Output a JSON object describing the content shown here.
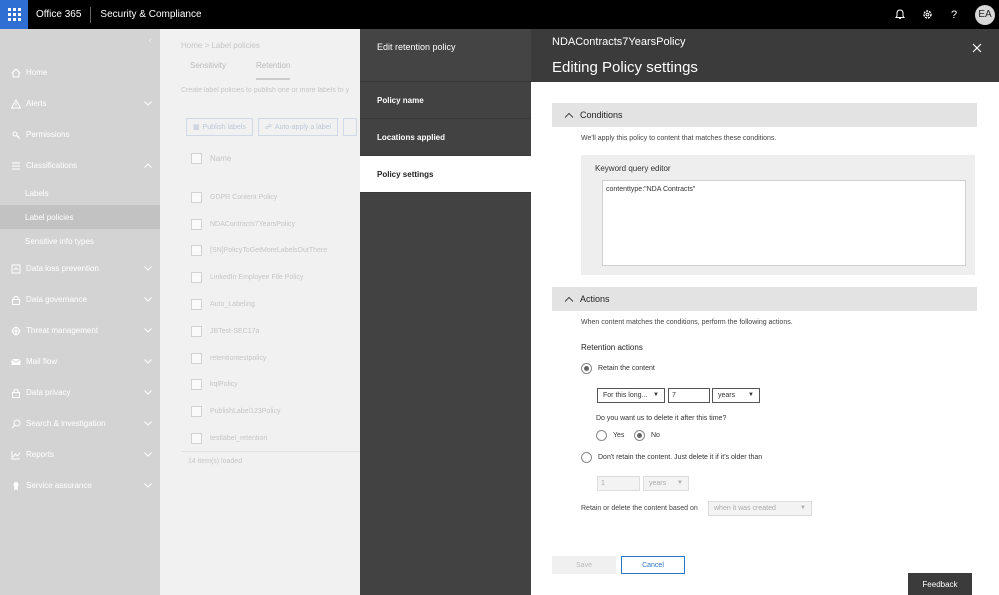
{
  "topbar": {
    "app_name": "Office 365",
    "suite_name": "Security & Compliance",
    "avatar_initials": "EA",
    "icons": [
      "bell-icon",
      "gear-icon",
      "help-icon"
    ]
  },
  "leftnav": {
    "items": [
      {
        "label": "Home",
        "icon": "home-icon",
        "chevron": false
      },
      {
        "label": "Alerts",
        "icon": "alert-icon",
        "chevron": true
      },
      {
        "label": "Permissions",
        "icon": "permissions-icon",
        "chevron": false
      },
      {
        "label": "Classifications",
        "icon": "classifications-icon",
        "chevron": true,
        "expanded": true
      }
    ],
    "subitems": [
      {
        "label": "Labels",
        "active": false
      },
      {
        "label": "Label policies",
        "active": true
      },
      {
        "label": "Sensitive info types",
        "active": false
      }
    ],
    "items_after": [
      {
        "label": "Data loss prevention",
        "icon": "dlp-icon"
      },
      {
        "label": "Data governance",
        "icon": "lock-icon"
      },
      {
        "label": "Threat management",
        "icon": "threat-icon"
      },
      {
        "label": "Mail flow",
        "icon": "mail-icon"
      },
      {
        "label": "Data privacy",
        "icon": "privacy-lock-icon"
      },
      {
        "label": "Search & investigation",
        "icon": "search-icon"
      },
      {
        "label": "Reports",
        "icon": "reports-icon"
      },
      {
        "label": "Service assurance",
        "icon": "service-icon"
      }
    ]
  },
  "mid": {
    "breadcrumb": "Home  >  Label policies",
    "tabs": [
      "Sensitivity",
      "Retention"
    ],
    "hint": "Create label policies to publish one or more labels to y",
    "buttons": [
      "Publish labels",
      "Auto-apply a label"
    ],
    "column_name": "Name",
    "rows": [
      "GDPR Content Policy",
      "NDAContracts7YearsPolicy",
      "[SN]PolicyToGetMoreLabelsOutThere",
      "LinkedIn Employee File Policy",
      "Auto_Labeling",
      "JBTest-SEC17a",
      "retentiontestpolicy",
      "kqlPolicy",
      "PublishLabel123Policy",
      "testlabel_retention"
    ],
    "loaded": "14 item(s) loaded"
  },
  "wizard": {
    "title": "Edit retention policy",
    "steps": [
      {
        "label": "Policy name",
        "active": false
      },
      {
        "label": "Locations applied",
        "active": false
      },
      {
        "label": "Policy settings",
        "active": true
      }
    ]
  },
  "editor": {
    "policy_name": "NDAContracts7YearsPolicy",
    "title": "Editing Policy settings",
    "conditions": {
      "header": "Conditions",
      "description": "We'll apply this policy to content that matches these conditions.",
      "kqe_label": "Keyword query editor",
      "kqe_value": "contenttype:\"NDA Contracts\""
    },
    "actions": {
      "header": "Actions",
      "description": "When content matches the conditions, perform the following actions.",
      "retention_label": "Retention actions",
      "retain_option": "Retain the content",
      "duration_select": "For this long...",
      "duration_value": "7",
      "unit_select": "years",
      "delete_question": "Do you want us to delete it after this time?",
      "yes": "Yes",
      "no": "No",
      "dont_retain_option": "Don't retain the content. Just delete it if it's older than",
      "dont_retain_value": "1",
      "dont_retain_unit": "years",
      "based_on_label": "Retain or delete the content based on",
      "based_on_value": "when it was created"
    },
    "save_label": "Save",
    "cancel_label": "Cancel",
    "feedback_label": "Feedback"
  }
}
